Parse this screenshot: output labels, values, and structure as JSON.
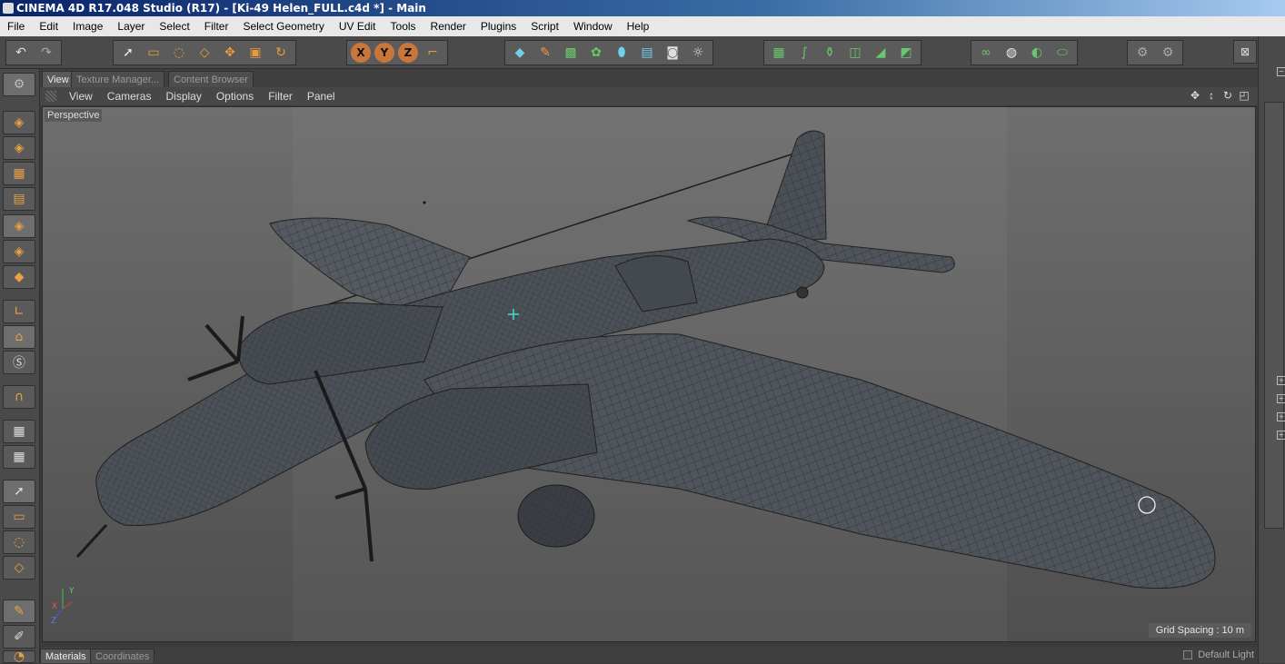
{
  "window": {
    "title": "CINEMA 4D R17.048 Studio (R17) - [Ki-49 Helen_FULL.c4d *] - Main"
  },
  "menu": [
    "File",
    "Edit",
    "Image",
    "Layer",
    "Select",
    "Filter",
    "Select Geometry",
    "UV Edit",
    "Tools",
    "Render",
    "Plugins",
    "Script",
    "Window",
    "Help"
  ],
  "toolbar": {
    "undo": {
      "icon": "undo-icon"
    },
    "redo": {
      "icon": "redo-icon"
    },
    "axes": [
      "X",
      "Y",
      "Z"
    ]
  },
  "tabs": {
    "view": "View",
    "texture_manager": "Texture Manager...",
    "content_browser": "Content Browser"
  },
  "view_menu": [
    "View",
    "Cameras",
    "Display",
    "Options",
    "Filter",
    "Panel"
  ],
  "viewport": {
    "camera_label": "Perspective",
    "grid_spacing": "Grid Spacing : 10 m",
    "axis_labels": {
      "x": "X",
      "y": "Y",
      "z": "Z"
    }
  },
  "bottom_tabs": {
    "materials": "Materials",
    "coordinates": "Coordinates"
  },
  "default_light": "Default Light",
  "colors": {
    "accent_orange": "#e9a045",
    "cyan_marker": "#3fe0d0",
    "title_blue": "#0a246a"
  }
}
